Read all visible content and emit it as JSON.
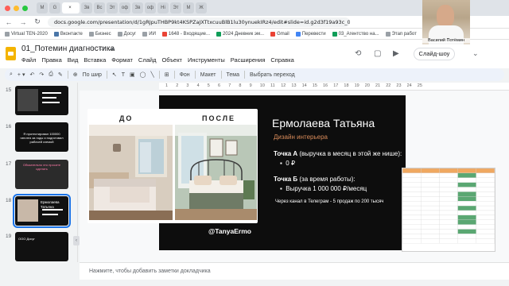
{
  "browser": {
    "tabs": [
      {
        "label": "M"
      },
      {
        "label": "G"
      },
      {
        "label": "Зв"
      },
      {
        "label": "Вс"
      },
      {
        "label": "Эт"
      },
      {
        "label": "оф"
      },
      {
        "label": "Зв"
      },
      {
        "label": "оф"
      },
      {
        "label": "Hi"
      },
      {
        "label": "Эт"
      },
      {
        "label": "М"
      },
      {
        "label": "Ж"
      }
    ],
    "active_tab_title": "×",
    "url": "docs.google.com/presentation/d/1gRJpuTHBP9kt4KSPZaJXTtxcuuBlB1lu30ynuekIRz4/edit#slide=id.g2d3f19a93c_0_0",
    "bookmarks": [
      "Virtual TEN-2020",
      "Вконтакте",
      "Бизнес",
      "Досуг",
      "ИИ",
      "1648 - Входящие...",
      "2024 Дневник эм...",
      "Gmail",
      "Перевести",
      "03_Агентство на...",
      "Этап работ"
    ]
  },
  "webcam": {
    "name": "Василий Потёмин"
  },
  "docs": {
    "title": "01_Потемин диагностика",
    "menu": [
      "Файл",
      "Правка",
      "Вид",
      "Вставка",
      "Формат",
      "Слайд",
      "Объект",
      "Инструменты",
      "Расширения",
      "Справка"
    ],
    "slideshow_label": "Слайд-шоу",
    "toolbar": {
      "zoom": "По шир",
      "background": "Фон",
      "layout": "Макет",
      "theme": "Тема",
      "transition": "Выбрать переход"
    },
    "ruler_ticks": [
      "1",
      "2",
      "3",
      "4",
      "5",
      "6",
      "7",
      "8",
      "9",
      "10",
      "11",
      "12",
      "13",
      "14",
      "15",
      "16",
      "17",
      "18",
      "19",
      "20",
      "21",
      "22",
      "23",
      "24",
      "25"
    ]
  },
  "filmstrip": {
    "slides": [
      {
        "num": "15",
        "text": ""
      },
      {
        "num": "16",
        "text": "Я протестировал 100000 гипотез за годы и подготовил рабочей схемой"
      },
      {
        "num": "17",
        "text": "Обязательно это просите сделать"
      },
      {
        "num": "18",
        "text": "Ермолаева Татьяна"
      },
      {
        "num": "19",
        "text": "ООО Досуг"
      }
    ],
    "selected": "18"
  },
  "slide": {
    "before_label": "ДО",
    "after_label": "ПОСЛЕ",
    "handle": "@TanyaErmo",
    "name": "Ермолаева Татьяна",
    "role": "Дизайн интерьера",
    "point_a_title": "Точка А",
    "point_a_rest": " (выручка в месяц в этой же нише):",
    "point_a_bullet": "0 ₽",
    "point_b_title": "Точка Б",
    "point_b_rest": " (за время работы):",
    "point_b_bullet": "Выручка 1 000 000 ₽/месяц",
    "note": "Через канал в Телеграм - 5 продаж по 200 тысяч"
  },
  "notes": {
    "placeholder": "Нажмите, чтобы добавить заметки докладчика"
  },
  "colors": {
    "accent": "#1a73e8",
    "role_orange": "#d98b5a",
    "slide_bg": "#0d0d0d",
    "sheet_green": "#5aa772",
    "sheet_orange": "#f0a860"
  }
}
